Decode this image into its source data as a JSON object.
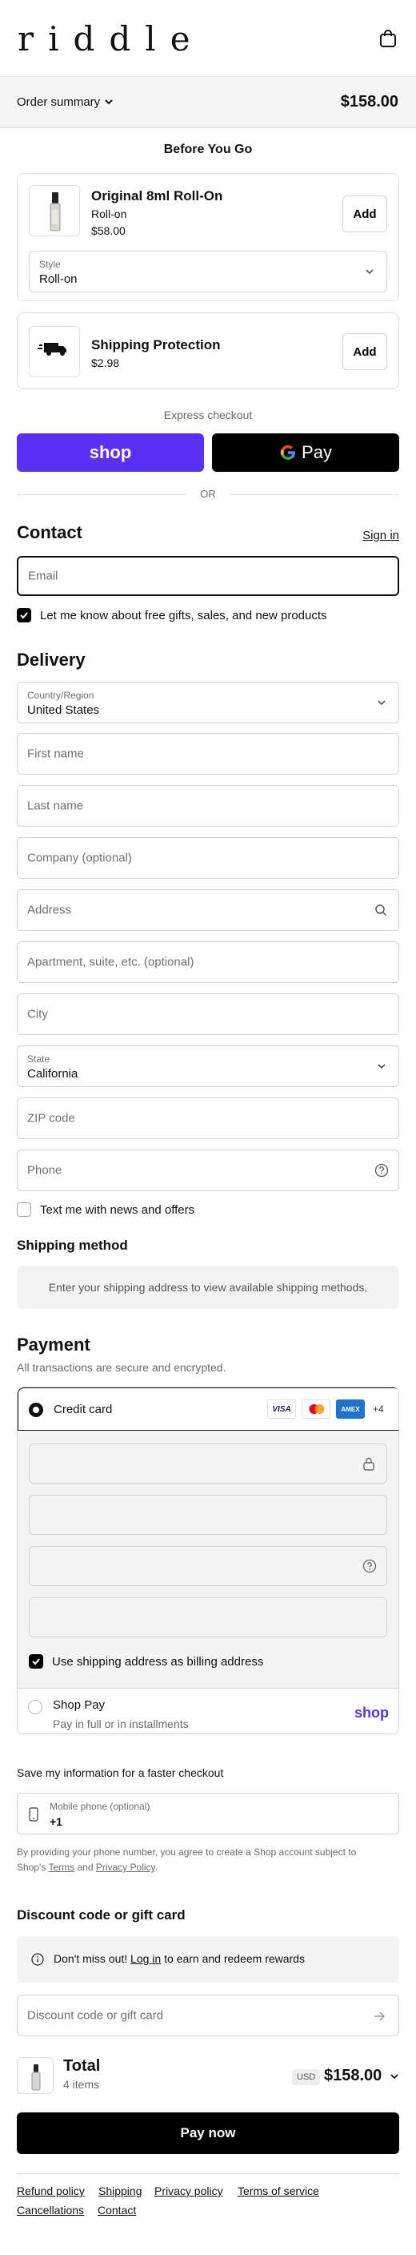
{
  "header": {
    "logo": "riddle"
  },
  "summary": {
    "label": "Order summary",
    "total": "$158.00"
  },
  "upsell": {
    "title": "Before You Go",
    "items": [
      {
        "name": "Original 8ml Roll-On",
        "variant": "Roll-on",
        "price": "$58.00",
        "add": "Add",
        "style_label": "Style",
        "style_value": "Roll-on"
      },
      {
        "name": "Shipping Protection",
        "price": "$2.98",
        "add": "Add"
      }
    ]
  },
  "express": {
    "title": "Express checkout",
    "shop": "shop",
    "gpay": "Pay",
    "or": "OR"
  },
  "contact": {
    "title": "Contact",
    "signin": "Sign in",
    "email_placeholder": "Email",
    "marketing": "Let me know about free gifts, sales, and new products"
  },
  "delivery": {
    "title": "Delivery",
    "country_label": "Country/Region",
    "country_value": "United States",
    "first_name": "First name",
    "last_name": "Last name",
    "company": "Company (optional)",
    "address": "Address",
    "apartment": "Apartment, suite, etc. (optional)",
    "city": "City",
    "state_label": "State",
    "state_value": "California",
    "zip": "ZIP code",
    "phone": "Phone",
    "sms": "Text me with news and offers"
  },
  "shipping": {
    "title": "Shipping method",
    "message": "Enter your shipping address to view available shipping methods."
  },
  "payment": {
    "title": "Payment",
    "subtitle": "All transactions are secure and encrypted.",
    "credit_card": "Credit card",
    "cards": [
      "VISA",
      "AMEX"
    ],
    "more_cards": "+4",
    "billing_same": "Use shipping address as billing address",
    "shop_pay": "Shop Pay",
    "shop_pay_sub": "Pay in full or in installments",
    "shop_logo": "shop"
  },
  "remember": {
    "title": "Save my information for a faster checkout",
    "mobile_label": "Mobile phone (optional)",
    "mobile_value": "+1",
    "legal_1": "By providing your phone number, you agree to create a Shop account subject to",
    "legal_2": "Shop's",
    "terms": "Terms",
    "and": "and",
    "privacy": "Privacy Policy",
    "period": "."
  },
  "discount": {
    "title": "Discount code or gift card",
    "banner_1": "Don't miss out!",
    "banner_link": "Log in",
    "banner_2": "to earn and redeem rewards",
    "placeholder": "Discount code or gift card"
  },
  "total": {
    "label": "Total",
    "items": "4 items",
    "currency": "USD",
    "amount": "$158.00"
  },
  "pay_button": "Pay now",
  "footer": {
    "links": [
      "Refund policy",
      "Shipping",
      "Privacy policy",
      "Terms of service",
      "Cancellations",
      "Contact"
    ]
  },
  "colors": {
    "shop_purple": "#5a31f4",
    "shop_logo": "#5a31f4",
    "amex": "#1f72cd",
    "mastercard_red": "#eb001b",
    "mastercard_orange": "#f79e1b"
  }
}
